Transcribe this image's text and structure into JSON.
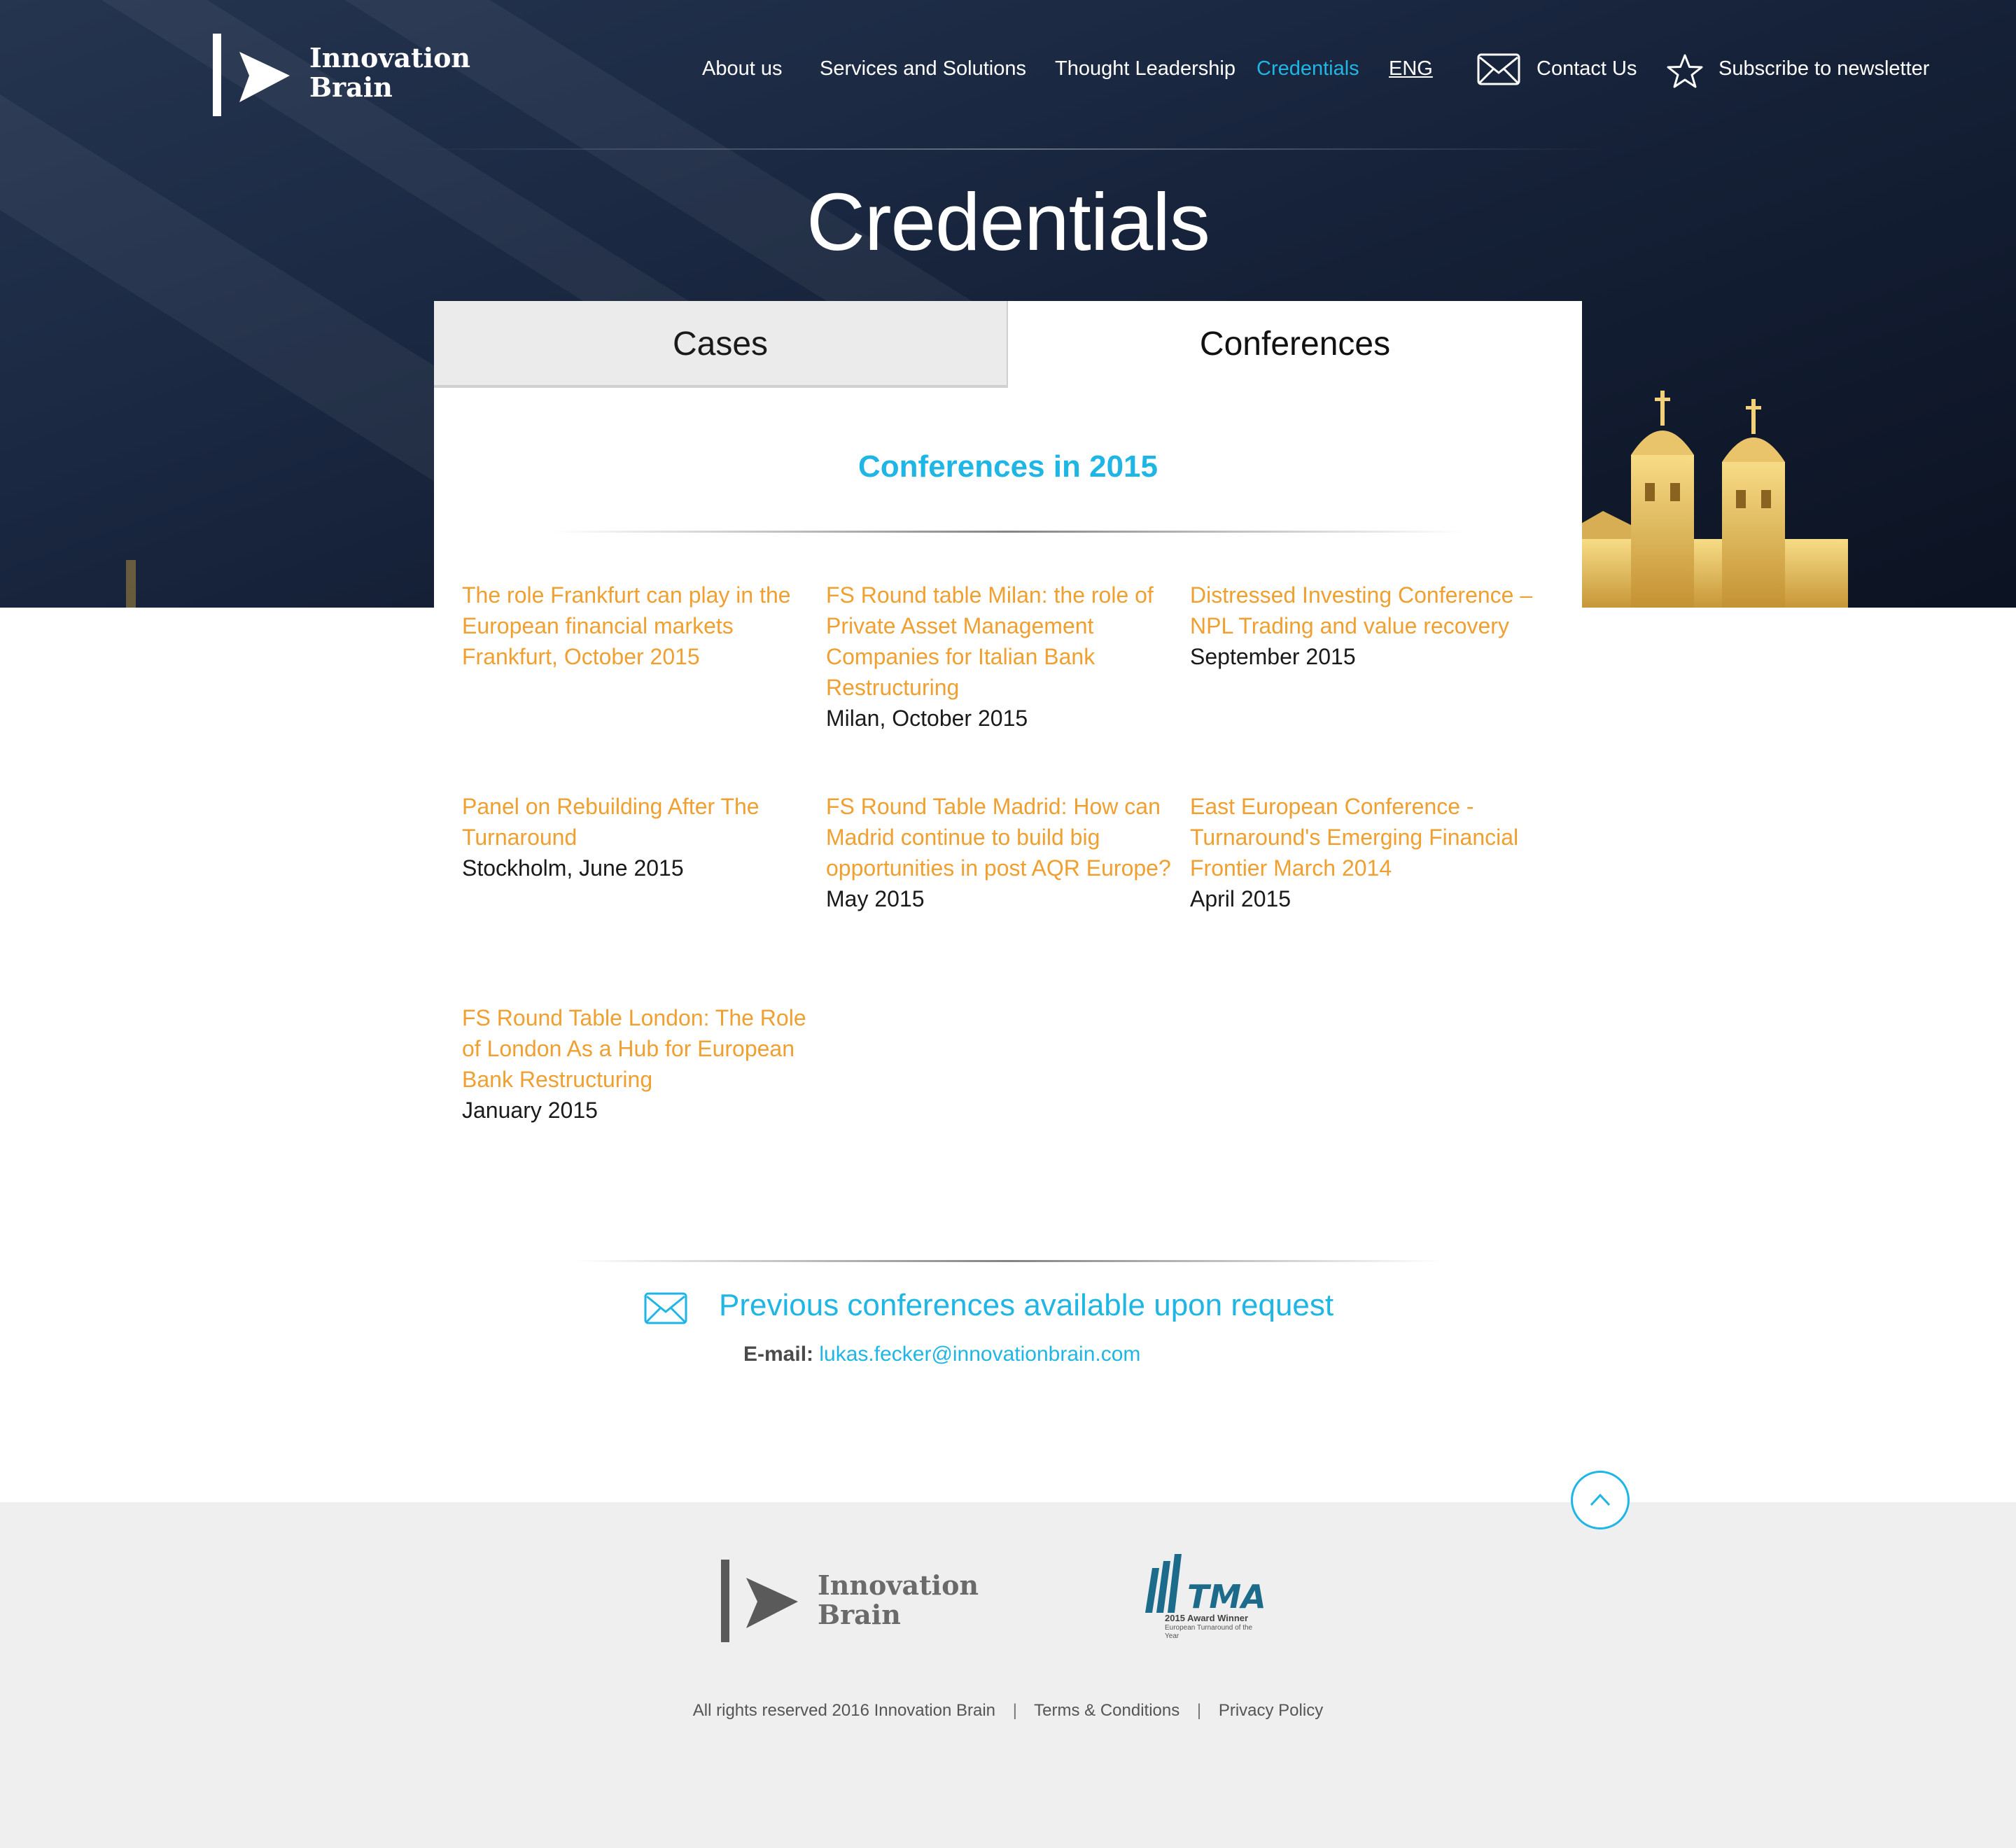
{
  "brand": {
    "name_line1": "Innovation",
    "name_line2": "Brain"
  },
  "nav": {
    "items": [
      {
        "label": "About us"
      },
      {
        "label": "Services and Solutions"
      },
      {
        "label": "Thought Leadership"
      },
      {
        "label": "Credentials",
        "active": true
      },
      {
        "label": "ENG"
      }
    ],
    "contact_label": "Contact Us",
    "subscribe_label": "Subscribe to newsletter"
  },
  "page": {
    "title": "Credentials"
  },
  "tabs": [
    {
      "label": "Cases",
      "selected": false
    },
    {
      "label": "Conferences",
      "selected": true
    }
  ],
  "section": {
    "title": "Conferences in 2015"
  },
  "conferences": [
    {
      "title": "The role Frankfurt can play in the European financial markets Frankfurt, October 2015",
      "date": ""
    },
    {
      "title": "FS Round table Milan: the role of Private Asset Management Companies for Italian Bank Restructuring",
      "date": "Milan, October 2015"
    },
    {
      "title": "Distressed Investing Conference – NPL Trading and value recovery",
      "date": "September 2015"
    },
    {
      "title": "Panel on Rebuilding After The Turnaround",
      "date": "Stockholm, June 2015"
    },
    {
      "title": "FS Round Table Madrid: How can Madrid continue to build big opportunities in post AQR Europe?",
      "date": "May 2015"
    },
    {
      "title": "East European Conference - Turnaround's Emerging Financial Frontier March 2014",
      "date": "April 2015"
    },
    {
      "title": "FS Round Table London: The Role of London As a Hub for European Bank Restructuring",
      "date": "January 2015"
    }
  ],
  "request": {
    "title": "Previous conferences available upon request",
    "email_label": "E-mail:",
    "email": "lukas.fecker@innovationbrain.com"
  },
  "footer": {
    "tma_logo": "TMA",
    "tma_award": "2015 Award Winner",
    "tma_sub": "European Turnaround of the Year",
    "copyright": "All rights reserved 2016 Innovation Brain",
    "terms": "Terms & Conditions",
    "privacy": "Privacy Policy"
  },
  "colors": {
    "accent": "#1fb6e6",
    "link_orange": "#f0a030",
    "hero_dark": "#141f35",
    "footer_bg": "#efefef"
  },
  "icons": [
    "envelope-icon",
    "star-icon",
    "chevron-up-icon"
  ]
}
